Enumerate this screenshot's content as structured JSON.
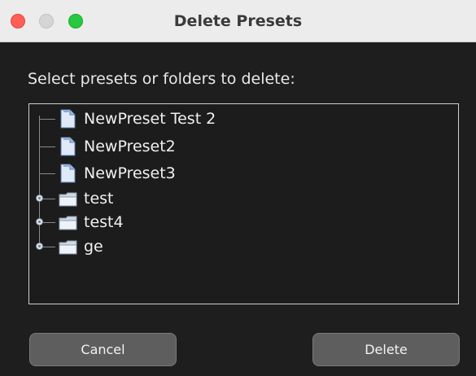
{
  "window": {
    "title": "Delete Presets"
  },
  "dialog": {
    "prompt": "Select presets or folders to delete:"
  },
  "tree": {
    "items": [
      {
        "label": "NewPreset Test 2",
        "kind": "preset",
        "icon": "file-icon"
      },
      {
        "label": "NewPreset2",
        "kind": "preset",
        "icon": "file-icon"
      },
      {
        "label": "NewPreset3",
        "kind": "preset",
        "icon": "file-icon"
      },
      {
        "label": "test",
        "kind": "folder",
        "icon": "folder-icon",
        "expanded": false
      },
      {
        "label": "test4",
        "kind": "folder",
        "icon": "folder-icon",
        "expanded": false
      },
      {
        "label": "ge",
        "kind": "folder",
        "icon": "folder-icon",
        "expanded": false
      }
    ]
  },
  "buttons": {
    "cancel_label": "Cancel",
    "delete_label": "Delete"
  },
  "colors": {
    "background": "#1e1e1e",
    "titlebar": "#ececec",
    "close": "#ff5f57",
    "maximize": "#28c840",
    "button": "#5e5e5e"
  }
}
